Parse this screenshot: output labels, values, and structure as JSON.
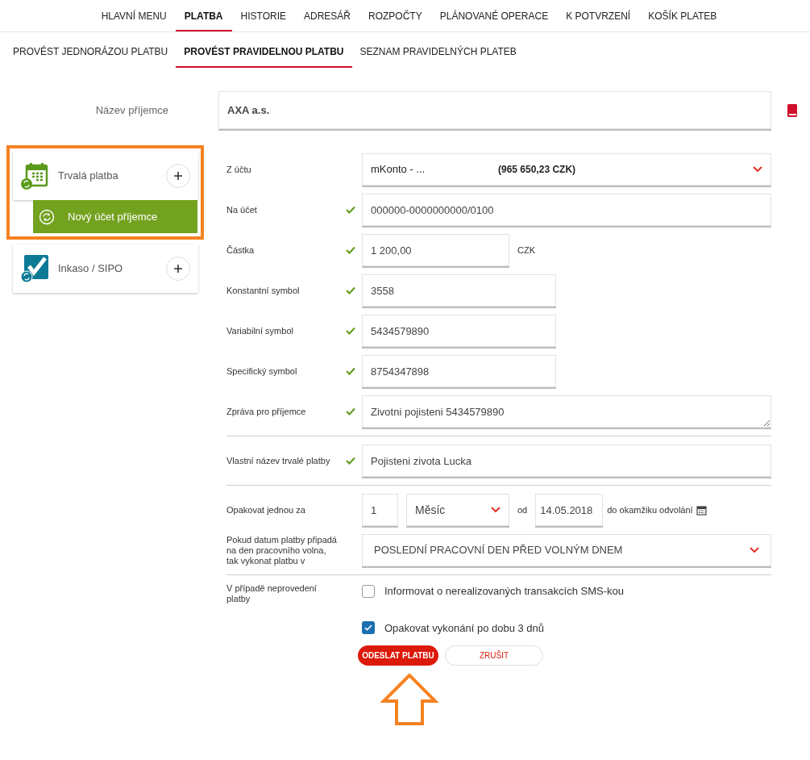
{
  "nav": {
    "items": [
      {
        "label": "HLAVNÍ MENU",
        "selected": false
      },
      {
        "label": "PLATBA",
        "selected": true
      },
      {
        "label": "HISTORIE",
        "selected": false
      },
      {
        "label": "ADRESÁŘ",
        "selected": false
      },
      {
        "label": "ROZPOČTY",
        "selected": false
      },
      {
        "label": "PLÁNOVANÉ OPERACE",
        "selected": false
      },
      {
        "label": "K POTVRZENÍ",
        "selected": false
      },
      {
        "label": "KOŠÍK PLATEB",
        "selected": false
      }
    ]
  },
  "subnav": {
    "items": [
      {
        "label": "PROVÉST JEDNORÁZOU PLATBU",
        "selected": false
      },
      {
        "label": "PROVÉST PRAVIDELNOU PLATBU",
        "selected": true
      },
      {
        "label": "SEZNAM PRAVIDELNÝCH PLATEB",
        "selected": false
      }
    ]
  },
  "recipient": {
    "label": "Název příjemce",
    "value": "AXA  a.s."
  },
  "sidebar": {
    "items": [
      {
        "label": "Trvalá platba",
        "kind": "calendar",
        "highlighted": true,
        "children": [
          {
            "label": "Nový účet příjemce",
            "selected": true
          }
        ]
      },
      {
        "label": "Inkaso / SIPO",
        "kind": "check",
        "highlighted": false
      }
    ]
  },
  "form": {
    "groups": [
      [
        {
          "kind": "account",
          "label": "Z účtu",
          "value": "mKonto - ...",
          "amount": "(965 650,23 CZK)"
        },
        {
          "kind": "text",
          "label": "Na účet",
          "valid": true,
          "value": "000000-0000000000/0100"
        },
        {
          "kind": "amount",
          "label": "Částka",
          "valid": true,
          "value": "1 200,00",
          "unit": "CZK"
        },
        {
          "kind": "symbol",
          "label": "Konstantní symbol",
          "valid": true,
          "value": "3558"
        },
        {
          "kind": "symbol",
          "label": "Variabilní symbol",
          "valid": true,
          "value": "5434579890"
        },
        {
          "kind": "symbol",
          "label": "Specifický symbol",
          "valid": true,
          "value": "8754347898"
        },
        {
          "kind": "textarea",
          "label": "Zpráva pro příjemce",
          "valid": true,
          "value": "Zivotni pojisteni 5434579890"
        }
      ],
      [
        {
          "kind": "text",
          "label": "Vlastní název trvalé platby",
          "valid": true,
          "value": "Pojisteni zivota Lucka"
        }
      ],
      [
        {
          "kind": "repeat",
          "label": "Opakovat jednou za",
          "count": "1",
          "period": "Měsíc",
          "from_label": "od",
          "date": "14.05.2018",
          "until": "do okamžiku odvolání"
        },
        {
          "kind": "select",
          "label": "Pokud datum platby připadá na den pracovního volna, tak vykonat platbu v",
          "value": "POSLEDNÍ PRACOVNÍ DEN PŘED VOLNÝM DNEM"
        }
      ],
      [
        {
          "kind": "checkboxes",
          "label": "V případě neprovedení platby",
          "options": [
            {
              "label": "Informovat o nerealizovaných transakcích SMS-kou",
              "checked": false
            },
            {
              "label": "Opakovat vykonání po dobu 3 dnů",
              "checked": true
            }
          ]
        }
      ]
    ],
    "buttons": [
      {
        "label": "ODESLAT PLATBU",
        "kind": "primary"
      },
      {
        "label": "ZRUŠIT",
        "kind": "secondary"
      }
    ]
  }
}
